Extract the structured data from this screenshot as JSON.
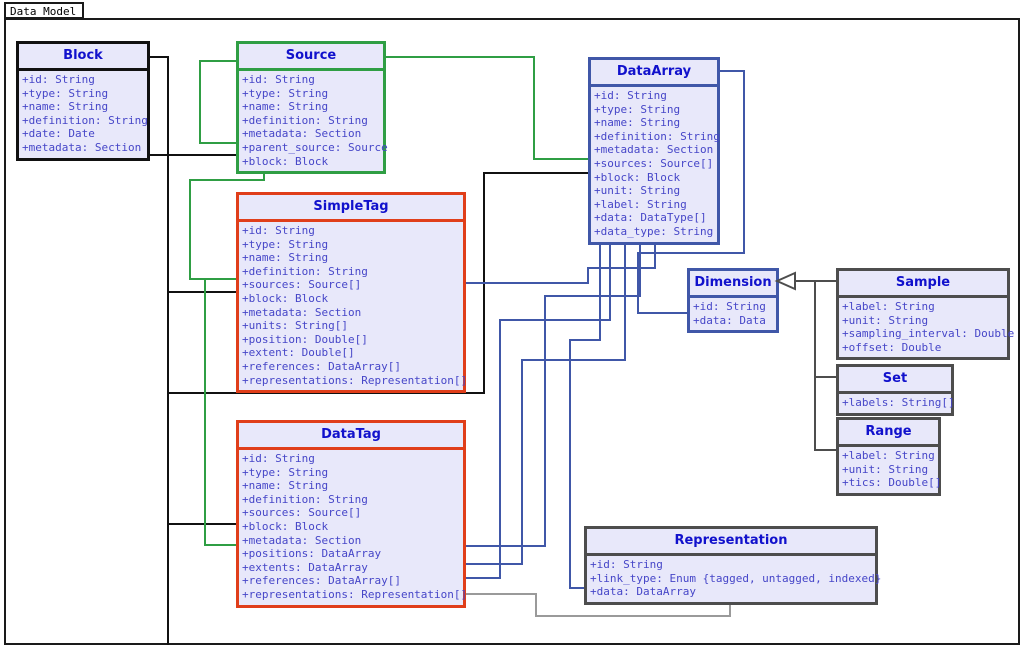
{
  "window": {
    "title": "Data Model"
  },
  "colors": {
    "box_fill": "#e8e8fa",
    "class_name": "#1111cc",
    "attribute": "#4646c8",
    "border_black": "#111111",
    "border_green": "#2f9e44",
    "border_blue": "#4057a8",
    "border_red": "#e03e1a",
    "border_gray": "#4d4d4d",
    "frame": "#1a1a1a",
    "background": "#ffffff"
  },
  "classes": [
    {
      "id": "block",
      "name": "Block",
      "border": "black",
      "attributes": [
        "+id: String",
        "+type: String",
        "+name: String",
        "+definition: String",
        "+date: Date",
        "+metadata: Section"
      ]
    },
    {
      "id": "source",
      "name": "Source",
      "border": "green",
      "attributes": [
        "+id: String",
        "+type: String",
        "+name: String",
        "+definition: String",
        "+metadata: Section",
        "+parent_source: Source",
        "+block: Block"
      ]
    },
    {
      "id": "dataarray",
      "name": "DataArray",
      "border": "blue",
      "attributes": [
        "+id: String",
        "+type: String",
        "+name: String",
        "+definition: String",
        "+metadata: Section",
        "+sources: Source[]",
        "+block: Block",
        "+unit: String",
        "+label: String",
        "+data: DataType[]",
        "+data_type: String"
      ]
    },
    {
      "id": "simpletag",
      "name": "SimpleTag",
      "border": "red",
      "attributes": [
        "+id: String",
        "+type: String",
        "+name: String",
        "+definition: String",
        "+sources: Source[]",
        "+block: Block",
        "+metadata: Section",
        "+units: String[]",
        "+position: Double[]",
        "+extent: Double[]",
        "+references: DataArray[]",
        "+representations: Representation[]"
      ]
    },
    {
      "id": "datatag",
      "name": "DataTag",
      "border": "red",
      "attributes": [
        "+id: String",
        "+type: String",
        "+name: String",
        "+definition: String",
        "+sources: Source[]",
        "+block: Block",
        "+metadata: Section",
        "+positions: DataArray",
        "+extents: DataArray",
        "+references: DataArray[]",
        "+representations: Representation[]"
      ]
    },
    {
      "id": "dimension",
      "name": "Dimension",
      "border": "blue",
      "attributes": [
        "+id: String",
        "+data: Data"
      ]
    },
    {
      "id": "sample",
      "name": "Sample",
      "border": "gray",
      "attributes": [
        "+label: String",
        "+unit: String",
        "+sampling_interval: Double",
        "+offset: Double"
      ]
    },
    {
      "id": "set",
      "name": "Set",
      "border": "gray",
      "attributes": [
        "+labels: String[]"
      ]
    },
    {
      "id": "range",
      "name": "Range",
      "border": "gray",
      "attributes": [
        "+label: String",
        "+unit: String",
        "+tics: Double[]"
      ]
    },
    {
      "id": "representation",
      "name": "Representation",
      "border": "gray",
      "attributes": [
        "+id: String",
        "+link_type: Enum {tagged, untagged, indexed}",
        "+data: DataArray"
      ]
    }
  ],
  "relationships": [
    {
      "from": "block",
      "to": "source",
      "type": "association",
      "color": "#111111"
    },
    {
      "from": "block",
      "to": "simpletag",
      "type": "association",
      "color": "#111111"
    },
    {
      "from": "block",
      "to": "datatag",
      "type": "association",
      "color": "#111111"
    },
    {
      "from": "block",
      "to": "dataarray",
      "type": "association",
      "color": "#111111"
    },
    {
      "from": "source",
      "to": "dataarray",
      "type": "association",
      "color": "#2f9e44"
    },
    {
      "from": "source",
      "to": "simpletag",
      "type": "association",
      "color": "#2f9e44"
    },
    {
      "from": "source",
      "to": "datatag",
      "type": "association",
      "color": "#2f9e44"
    },
    {
      "from": "dataarray",
      "to": "dimension",
      "type": "association",
      "color": "#4057a8"
    },
    {
      "from": "dataarray",
      "to": "simpletag",
      "type": "association",
      "color": "#4057a8"
    },
    {
      "from": "dataarray",
      "to": "datatag",
      "type": "association",
      "color": "#4057a8"
    },
    {
      "from": "dataarray",
      "to": "representation",
      "type": "association",
      "color": "#4057a8"
    },
    {
      "from": "sample",
      "to": "dimension",
      "type": "inheritance",
      "color": "#4d4d4d"
    },
    {
      "from": "set",
      "to": "dimension",
      "type": "inheritance",
      "color": "#4d4d4d"
    },
    {
      "from": "range",
      "to": "dimension",
      "type": "inheritance",
      "color": "#4d4d4d"
    },
    {
      "from": "datatag",
      "to": "representation",
      "type": "association",
      "color": "#9a9a9a"
    }
  ]
}
